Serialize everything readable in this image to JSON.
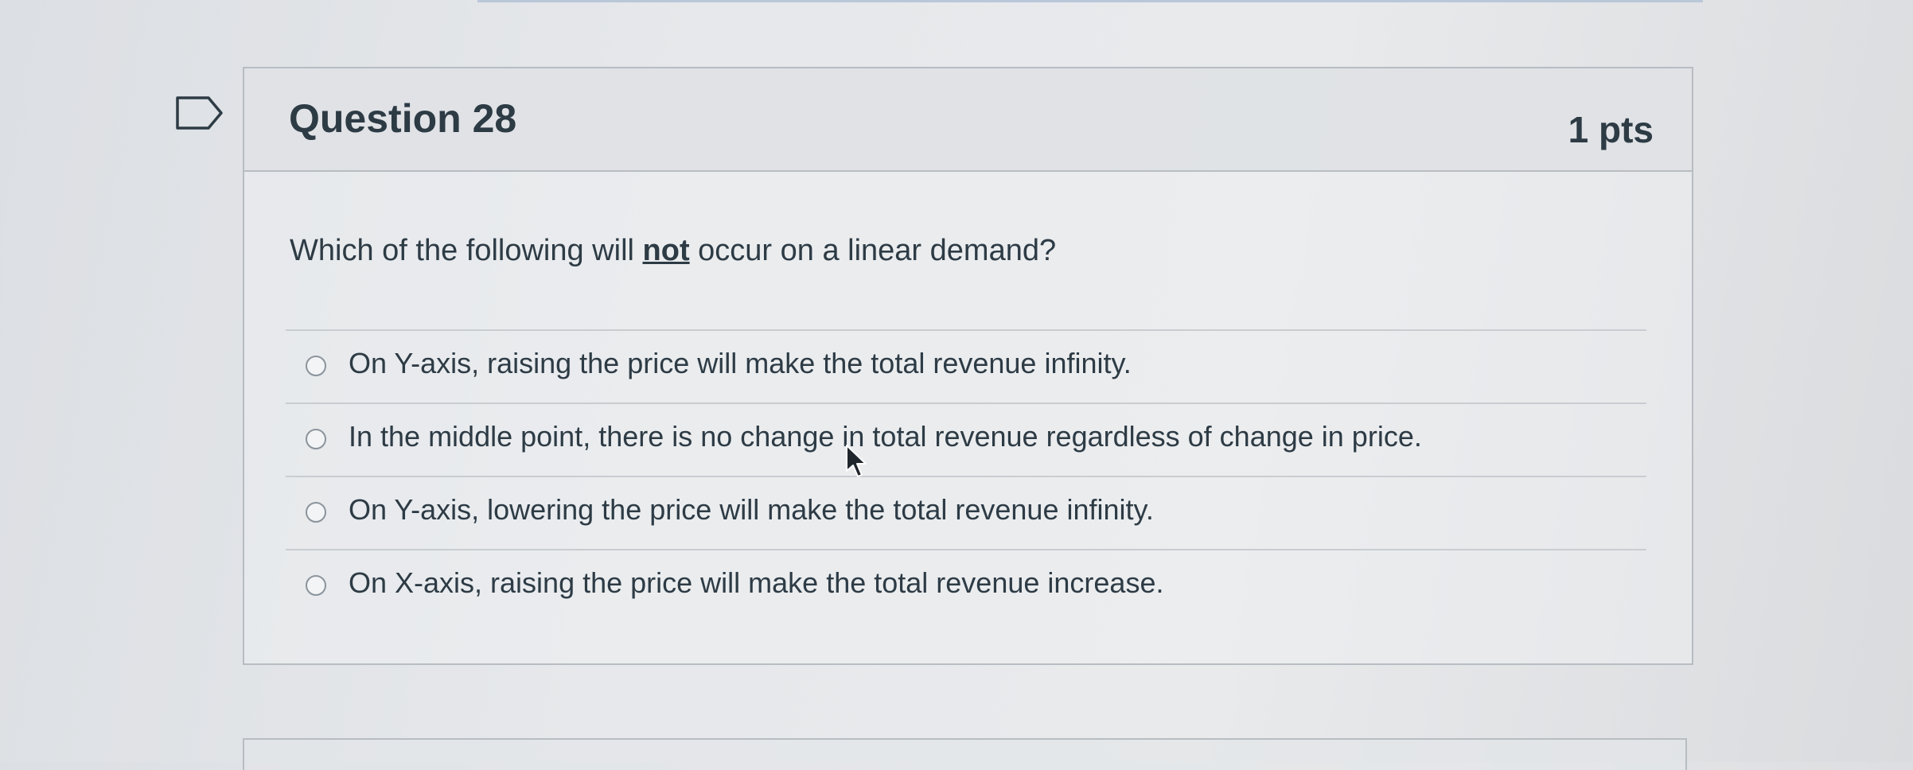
{
  "question": {
    "title": "Question 28",
    "points": "1 pts",
    "text_before": "Which of the following will ",
    "text_emphasis": "not",
    "text_after": " occur on a linear demand?",
    "answers": [
      {
        "label": "On Y-axis, raising the price will make the total revenue infinity.",
        "selected": false
      },
      {
        "label": "In the middle point, there is no change in total revenue regardless of change in price.",
        "selected": false
      },
      {
        "label": "On Y-axis, lowering the price will make the total revenue infinity.",
        "selected": false
      },
      {
        "label": "On X-axis, raising the price will make the total revenue increase.",
        "selected": false
      }
    ]
  },
  "icons": {
    "flag": "flag-question-icon",
    "radio": "radio-button-icon",
    "cursor": "mouse-pointer-icon"
  },
  "colors": {
    "text": "#2d3b45",
    "border": "#b7bdc2",
    "header_bg": "#dee1e4",
    "page_bg": "#e6e8eb"
  }
}
